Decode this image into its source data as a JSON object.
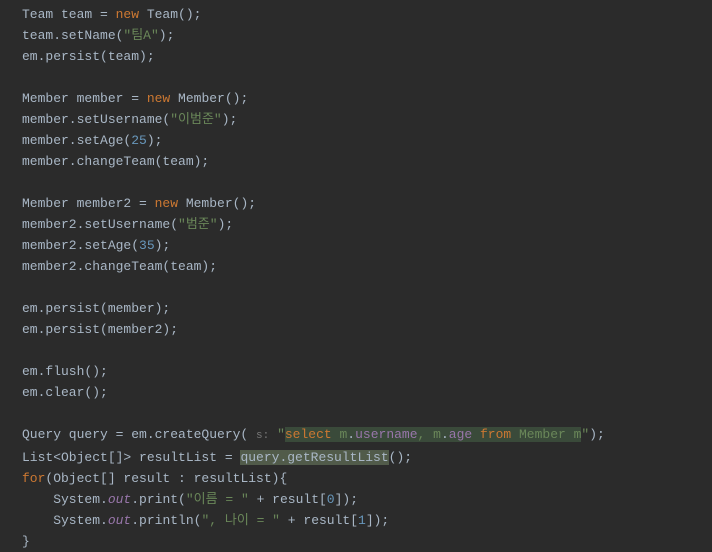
{
  "code": {
    "l1_a": "Team team = ",
    "l1_new": "new",
    "l1_b": " Team();",
    "l2_a": "team.setName(",
    "l2_str": "\"팀A\"",
    "l2_b": ");",
    "l3": "em.persist(team);",
    "l5_a": "Member member = ",
    "l5_new": "new",
    "l5_b": " Member();",
    "l6_a": "member.setUsername(",
    "l6_str": "\"이범준\"",
    "l6_b": ");",
    "l7_a": "member.setAge(",
    "l7_num": "25",
    "l7_b": ");",
    "l8": "member.changeTeam(team);",
    "l10_a": "Member member2 = ",
    "l10_new": "new",
    "l10_b": " Member();",
    "l11_a": "member2.setUsername(",
    "l11_str": "\"범준\"",
    "l11_b": ");",
    "l12_a": "member2.setAge(",
    "l12_num": "35",
    "l12_b": ");",
    "l13": "member2.changeTeam(team);",
    "l15": "em.persist(member);",
    "l16": "em.persist(member2);",
    "l18": "em.flush();",
    "l19": "em.clear();",
    "l21_a": "Query query = em.createQuery( ",
    "l21_hint": "s:",
    "l21_q1": "\"",
    "l21_sel": "select",
    "l21_sp1": " m",
    "l21_dot1": ".",
    "l21_user": "username",
    "l21_comma": ",",
    "l21_sp2": " m",
    "l21_dot2": ".",
    "l21_age": "age",
    "l21_sp3": " ",
    "l21_from": "from",
    "l21_sp4": " Member m",
    "l21_q2": "\"",
    "l21_b": ");",
    "l22_a": "List<Object[]> resultList = ",
    "l22_hi": "query.getResultList",
    "l22_b": "();",
    "l23_for": "for",
    "l23_a": "(Object[] result : resultList){",
    "l24_a": "    System.",
    "l24_out": "out",
    "l24_b": ".print(",
    "l24_str": "\"이름 = \"",
    "l24_c": " + result[",
    "l24_num": "0",
    "l24_d": "]);",
    "l25_a": "    System.",
    "l25_out": "out",
    "l25_b": ".println(",
    "l25_str": "\", 나이 = \"",
    "l25_c": " + result[",
    "l25_num": "1",
    "l25_d": "]);",
    "l26": "}"
  }
}
